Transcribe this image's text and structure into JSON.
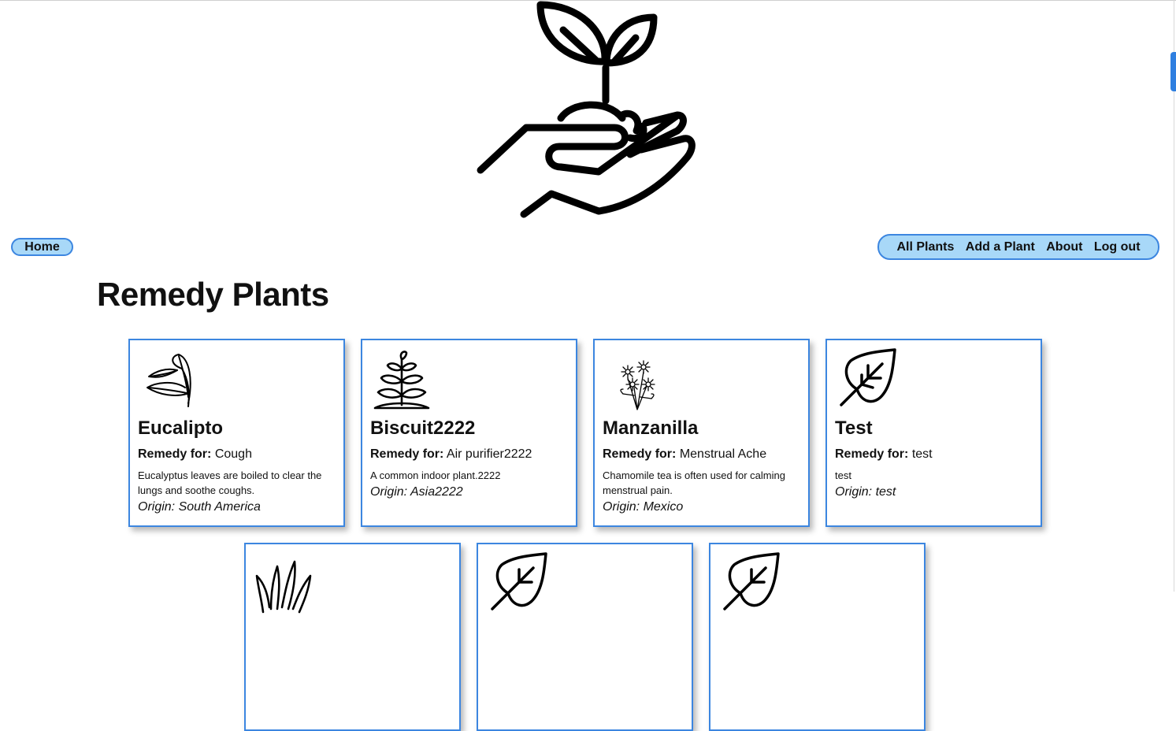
{
  "nav": {
    "home": "Home",
    "links": [
      "All Plants",
      "Add a Plant",
      "About",
      "Log out"
    ]
  },
  "page_title": "Remedy Plants",
  "labels": {
    "remedy_for": "Remedy for:"
  },
  "plants": [
    {
      "name": "Eucalipto",
      "remedy": "Cough",
      "description": "Eucalyptus leaves are boiled to clear the lungs and soothe coughs.",
      "origin": "Origin: South America",
      "icon": "eucalyptus-icon"
    },
    {
      "name": "Biscuit2222",
      "remedy": "Air purifier2222",
      "description": "A common indoor plant.2222",
      "origin": "Origin: Asia2222",
      "icon": "sprout-plant-icon"
    },
    {
      "name": "Manzanilla",
      "remedy": "Menstrual Ache",
      "description": "Chamomile tea is often used for calming menstrual pain.",
      "origin": "Origin: Mexico",
      "icon": "chamomile-flower-icon"
    },
    {
      "name": "Test",
      "remedy": "test",
      "description": "test",
      "origin": "Origin: test",
      "icon": "leaf-icon"
    }
  ],
  "partial_cards": [
    {
      "icon": "grass-icon"
    },
    {
      "icon": "leaf-icon"
    },
    {
      "icon": "leaf-icon"
    }
  ],
  "colors": {
    "accent_border": "#3c86e0",
    "pill_fill": "#a8d8f8"
  }
}
